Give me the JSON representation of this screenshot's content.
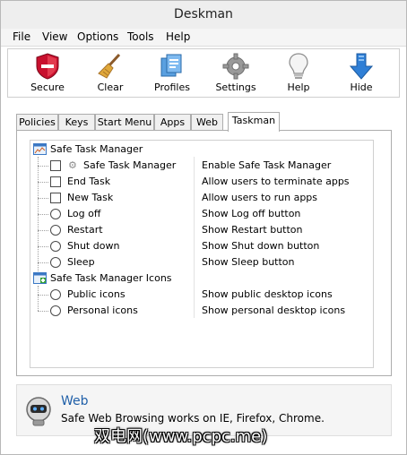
{
  "window": {
    "title": "Deskman"
  },
  "menu": [
    "File",
    "View",
    "Options",
    "Tools",
    "Help"
  ],
  "toolbar": {
    "buttons": [
      {
        "label": "Secure",
        "icon": "shield-icon"
      },
      {
        "label": "Clear",
        "icon": "broom-icon"
      },
      {
        "label": "Profiles",
        "icon": "profiles-icon"
      },
      {
        "label": "Settings",
        "icon": "gear-icon"
      },
      {
        "label": "Help",
        "icon": "lightbulb-icon"
      },
      {
        "label": "Hide",
        "icon": "down-arrow-icon"
      }
    ]
  },
  "tabs": {
    "items": [
      "Policies",
      "Keys",
      "Start Menu",
      "Apps",
      "Web",
      "Taskman"
    ],
    "active": "Taskman"
  },
  "tree": {
    "group1": {
      "title": "Safe Task Manager",
      "rows": [
        {
          "name": "Safe Task Manager",
          "desc": "Enable Safe Task Manager",
          "control": "checkbox"
        },
        {
          "name": "End Task",
          "desc": "Allow users to terminate apps",
          "control": "checkbox"
        },
        {
          "name": "New Task",
          "desc": "Allow users to run apps",
          "control": "checkbox"
        },
        {
          "name": "Log off",
          "desc": "Show Log off button",
          "control": "radio"
        },
        {
          "name": "Restart",
          "desc": "Show Restart button",
          "control": "radio"
        },
        {
          "name": "Shut down",
          "desc": "Show Shut down button",
          "control": "radio"
        },
        {
          "name": "Sleep",
          "desc": "Show Sleep button",
          "control": "radio"
        }
      ]
    },
    "group2": {
      "title": "Safe Task Manager Icons",
      "rows": [
        {
          "name": "Public icons",
          "desc": "Show public desktop icons",
          "control": "radio"
        },
        {
          "name": "Personal icons",
          "desc": "Show personal desktop icons",
          "control": "radio"
        }
      ]
    }
  },
  "info": {
    "title": "Web",
    "text": "Safe Web Browsing works on IE, Firefox, Chrome.",
    "icon": "robot-icon"
  },
  "watermark": "双电网(www.pcpc.me)",
  "colors": {
    "link": "#1f5fa8",
    "tab_border": "#adadad"
  }
}
